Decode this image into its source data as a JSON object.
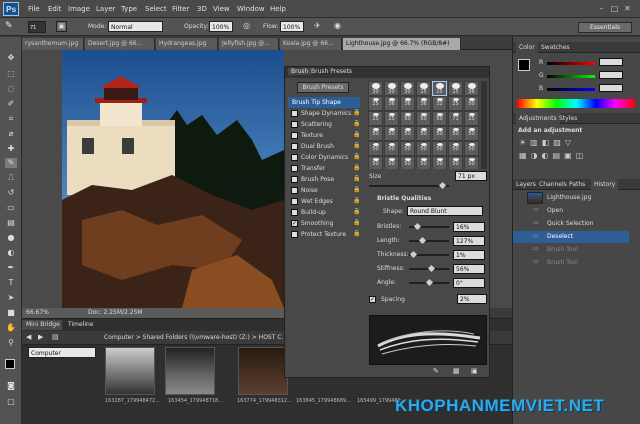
{
  "app": {
    "logo": "Ps",
    "menus": [
      "File",
      "Edit",
      "Image",
      "Layer",
      "Type",
      "Select",
      "Filter",
      "3D",
      "View",
      "Window",
      "Help"
    ]
  },
  "options": {
    "mode_label": "Mode:",
    "mode_value": "Normal",
    "opacity_label": "Opacity:",
    "opacity_value": "100%",
    "flow_label": "Flow:",
    "flow_value": "100%",
    "workspace": "Essentials",
    "brush_size": "71"
  },
  "tabs": [
    "rysanthemum.jpg",
    "Desert.jpg @ 66...",
    "Hydrangeas.jpg",
    "Jellyfish.jpg @...",
    "Koala.jpg @ 66...",
    "Lighthouse.jpg @ 66.7% (RGB/8#)"
  ],
  "status": {
    "zoom": "66.67%",
    "doc": "Doc: 2.25M/2.25M"
  },
  "bridge": {
    "tabs": [
      "Mini Bridge",
      "Timeline"
    ],
    "path": "Computer > Shared Folders (\\\\vmware-host) (Z:) > HOST C...",
    "sidebar_item": "Computer",
    "thumbs": [
      "163287_179948472...",
      "163454_179948718...",
      "163774_179948312...",
      "163845_179948689...",
      "165499_1799482..."
    ]
  },
  "brush": {
    "tabs": [
      "Brush",
      "Brush Presets"
    ],
    "presets_button": "Brush Presets",
    "options": [
      "Brush Tip Shape",
      "Shape Dynamics",
      "Scattering",
      "Texture",
      "Dual Brush",
      "Color Dynamics",
      "Transfer",
      "Brush Pose",
      "Noise",
      "Wet Edges",
      "Build-up",
      "Smoothing",
      "Protect Texture"
    ],
    "checked": [
      false,
      false,
      false,
      false,
      false,
      false,
      false,
      false,
      false,
      false,
      false,
      true,
      false
    ],
    "tips": [
      "30",
      "30",
      "30",
      "25",
      "25",
      "25",
      "36",
      "25",
      "36",
      "36",
      "36",
      "32",
      "25",
      "50",
      "25",
      "25",
      "50",
      "50",
      "50",
      "71",
      "25",
      "50",
      "50",
      "50",
      "50",
      "50",
      "50",
      "50",
      "50",
      "50",
      "50",
      "50",
      "50",
      "50",
      "50",
      "50",
      "50",
      "50",
      "50",
      "50",
      "50",
      "50"
    ],
    "size_label": "Size",
    "size_value": "71 px",
    "bristle_title": "Bristle Qualities",
    "shape_label": "Shape:",
    "shape_value": "Round Blunt",
    "params": [
      {
        "label": "Bristles:",
        "value": "16%",
        "pct": 0.16
      },
      {
        "label": "Length:",
        "value": "127%",
        "pct": 0.3
      },
      {
        "label": "Thickness:",
        "value": "1%",
        "pct": 0.05
      },
      {
        "label": "Stiffness:",
        "value": "56%",
        "pct": 0.56
      },
      {
        "label": "Angle:",
        "value": "0°",
        "pct": 0.5
      }
    ],
    "spacing_label": "Spacing",
    "spacing_value": "2%"
  },
  "right": {
    "color_tabs": [
      "Color",
      "Swatches"
    ],
    "channels": [
      "R",
      "G",
      "B"
    ],
    "adj_tabs": [
      "Adjustments",
      "Styles"
    ],
    "adj_title": "Add an adjustment",
    "hist_tabs": [
      "Layers",
      "Channels",
      "Paths",
      "History"
    ],
    "history": [
      "Lighthouse.jpg",
      "Open",
      "Quick Selection",
      "Deselect",
      "Brush Tool",
      "Brush Tool"
    ]
  },
  "watermark": "KHOPHANMEMVIET.NET"
}
